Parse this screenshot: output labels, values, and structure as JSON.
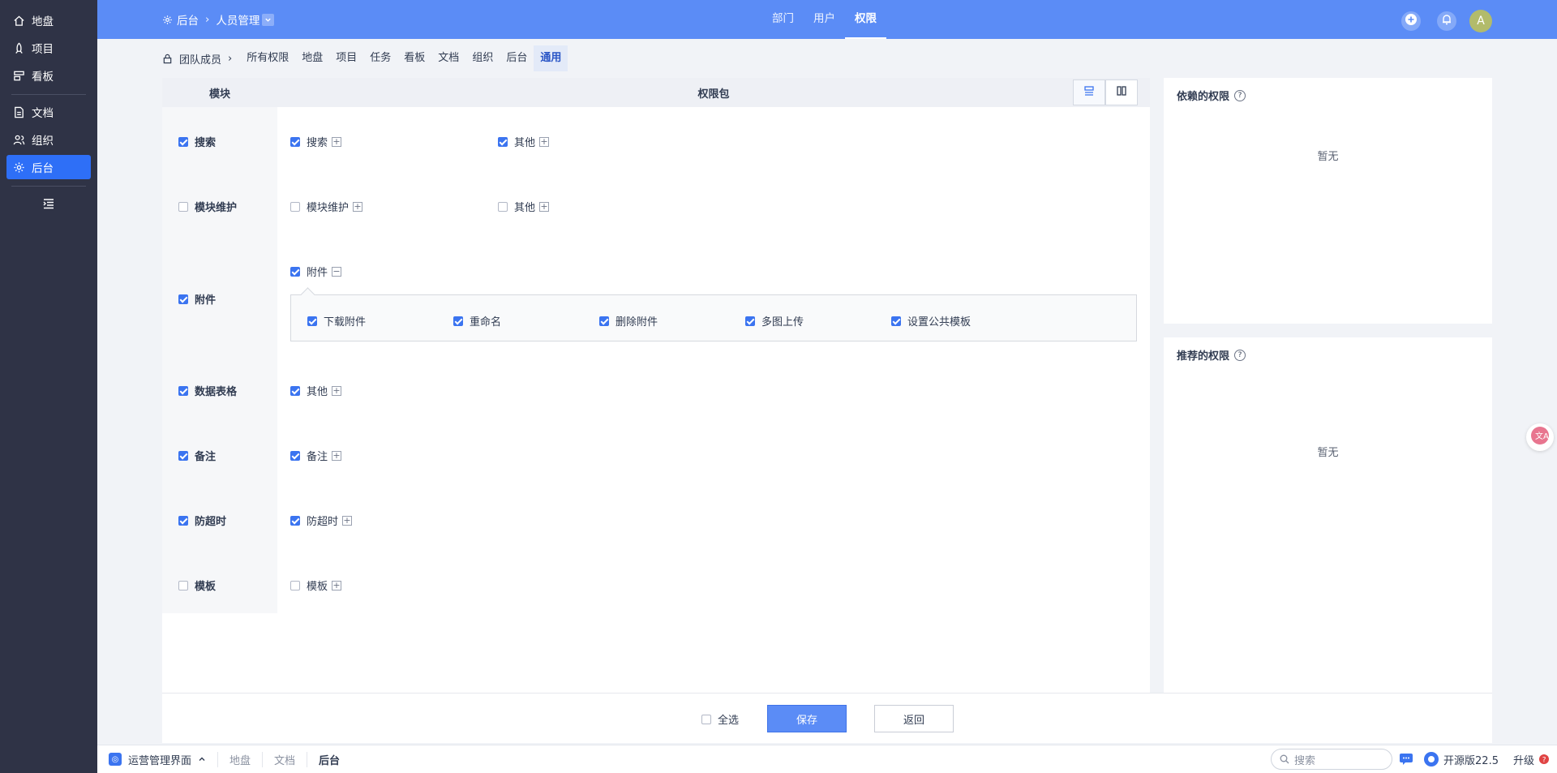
{
  "sidebar": {
    "items": [
      {
        "label": "地盘",
        "icon": "home-icon"
      },
      {
        "label": "项目",
        "icon": "rocket-icon"
      },
      {
        "label": "看板",
        "icon": "kanban-icon"
      },
      {
        "label": "文档",
        "icon": "document-icon"
      },
      {
        "label": "组织",
        "icon": "users-icon"
      },
      {
        "label": "后台",
        "icon": "gear-icon"
      }
    ]
  },
  "topbar": {
    "breadcrumb_root": "后台",
    "breadcrumb_current": "人员管理",
    "tabs": [
      "部门",
      "用户",
      "权限"
    ],
    "avatar": "A"
  },
  "subnav": {
    "team": "团队成员",
    "tabs": [
      "所有权限",
      "地盘",
      "项目",
      "任务",
      "看板",
      "文档",
      "组织",
      "后台",
      "通用"
    ]
  },
  "table": {
    "col_module": "模块",
    "col_package": "权限包"
  },
  "modules": [
    {
      "name": "搜索",
      "checked": true,
      "perms": [
        {
          "label": "搜索",
          "checked": true,
          "toggle": "+"
        },
        {
          "label": "其他",
          "checked": true,
          "toggle": "+"
        }
      ]
    },
    {
      "name": "模块维护",
      "checked": false,
      "perms": [
        {
          "label": "模块维护",
          "checked": false,
          "toggle": "+"
        },
        {
          "label": "其他",
          "checked": false,
          "toggle": "+"
        }
      ]
    },
    {
      "name": "附件",
      "checked": true,
      "perms": [
        {
          "label": "附件",
          "checked": true,
          "toggle": "−"
        }
      ],
      "sub": [
        {
          "label": "下载附件",
          "checked": true
        },
        {
          "label": "重命名",
          "checked": true
        },
        {
          "label": "删除附件",
          "checked": true
        },
        {
          "label": "多图上传",
          "checked": true
        },
        {
          "label": "设置公共模板",
          "checked": true
        }
      ]
    },
    {
      "name": "数据表格",
      "checked": true,
      "perms": [
        {
          "label": "其他",
          "checked": true,
          "toggle": "+"
        }
      ]
    },
    {
      "name": "备注",
      "checked": true,
      "perms": [
        {
          "label": "备注",
          "checked": true,
          "toggle": "+"
        }
      ]
    },
    {
      "name": "防超时",
      "checked": true,
      "perms": [
        {
          "label": "防超时",
          "checked": true,
          "toggle": "+"
        }
      ]
    },
    {
      "name": "模板",
      "checked": false,
      "perms": [
        {
          "label": "模板",
          "checked": false,
          "toggle": "+"
        }
      ]
    }
  ],
  "side": {
    "depends_title": "依赖的权限",
    "recommend_title": "推荐的权限",
    "empty": "暂无"
  },
  "footer": {
    "select_all": "全选",
    "save": "保存",
    "back": "返回"
  },
  "statusbar": {
    "app": "运营管理界面",
    "tabs": [
      "地盘",
      "文档",
      "后台"
    ],
    "search_placeholder": "搜索",
    "version": "开源版22.5",
    "upgrade": "升级"
  }
}
